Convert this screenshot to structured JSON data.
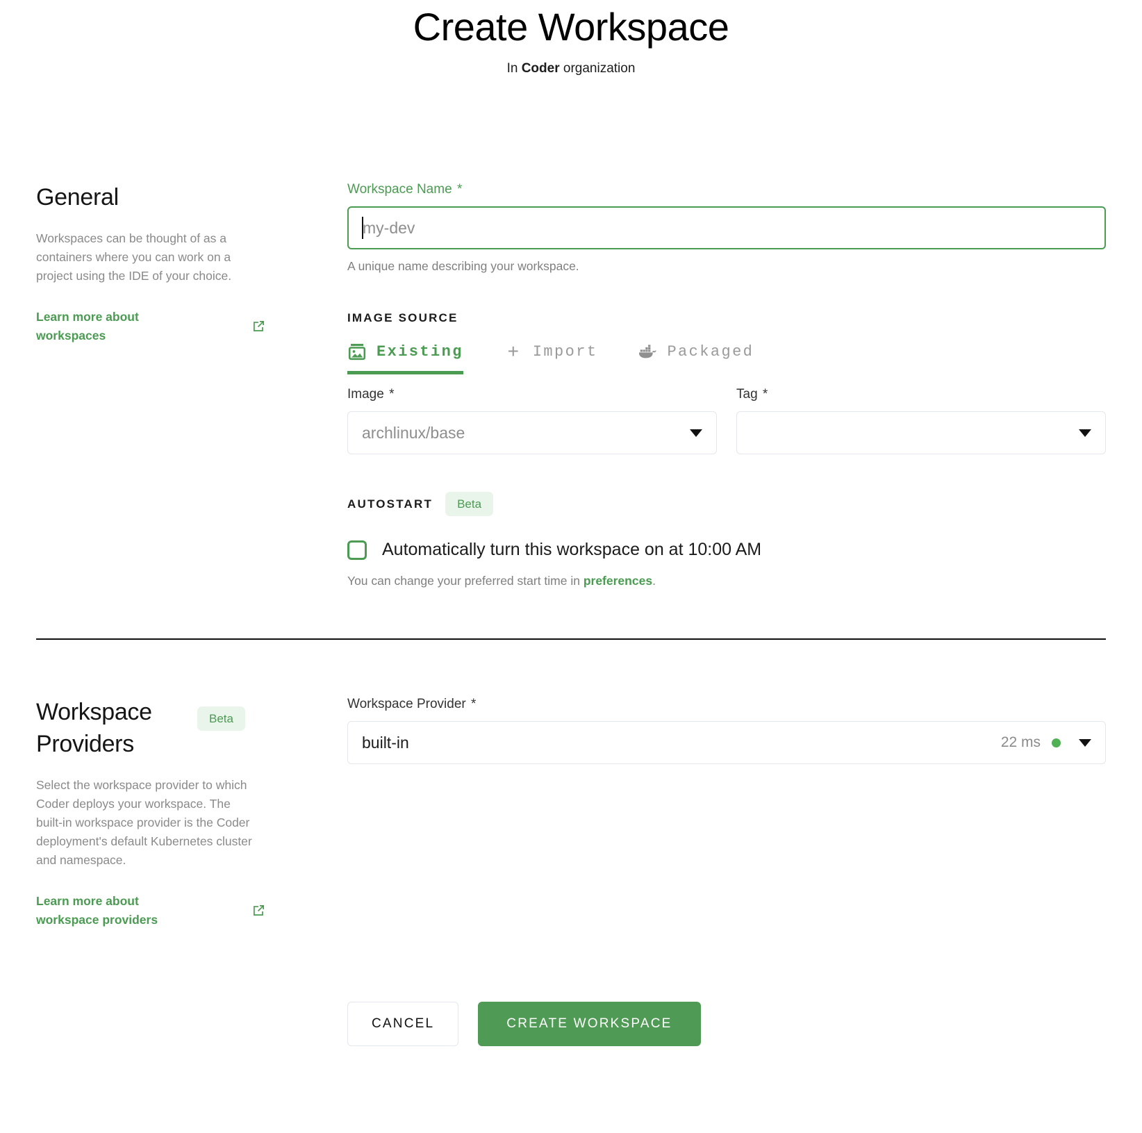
{
  "header": {
    "title": "Create Workspace",
    "subtitle_prefix": "In ",
    "subtitle_org": "Coder",
    "subtitle_suffix": " organization"
  },
  "general": {
    "title": "General",
    "description": "Workspaces can be thought of as a containers where you can work on a project using the IDE of your choice.",
    "learn_more": "Learn more about workspaces",
    "external_icon": "external-link-icon"
  },
  "workspace_name": {
    "label": "Workspace Name",
    "required_mark": "*",
    "placeholder": "my-dev",
    "value": "",
    "helper": "A unique name describing your workspace."
  },
  "image_source": {
    "group_label": "IMAGE SOURCE",
    "tabs": [
      {
        "label": "Existing",
        "icon": "image-icon",
        "active": true
      },
      {
        "label": "Import",
        "icon": "plus-icon",
        "active": false
      },
      {
        "label": "Packaged",
        "icon": "docker-icon",
        "active": false
      }
    ],
    "image": {
      "label": "Image",
      "required_mark": "*",
      "value": "archlinux/base",
      "filled": false
    },
    "tag": {
      "label": "Tag",
      "required_mark": "*",
      "value": "",
      "filled": false
    }
  },
  "autostart": {
    "group_label": "AUTOSTART",
    "badge": "Beta",
    "checkbox_label": "Automatically turn this workspace on at 10:00 AM",
    "checked": false,
    "helper_prefix": "You can change your preferred start time in ",
    "helper_link": "preferences",
    "helper_suffix": "."
  },
  "providers": {
    "title": "Workspace Providers",
    "badge": "Beta",
    "description": "Select the workspace provider to which Coder deploys your workspace. The built-in workspace provider is the Coder deployment's default Kubernetes cluster and namespace.",
    "learn_more": "Learn more about workspace providers",
    "external_icon": "external-link-icon",
    "field": {
      "label": "Workspace Provider",
      "required_mark": "*",
      "value": "built-in",
      "latency": "22 ms",
      "status_color": "#4fb054"
    }
  },
  "footer": {
    "cancel_label": "CANCEL",
    "create_label": "CREATE WORKSPACE"
  },
  "colors": {
    "accent_green": "#4b9b52",
    "button_green": "#4f9a54",
    "badge_bg": "#e9f4ea",
    "muted_text": "#8a8a8a"
  }
}
